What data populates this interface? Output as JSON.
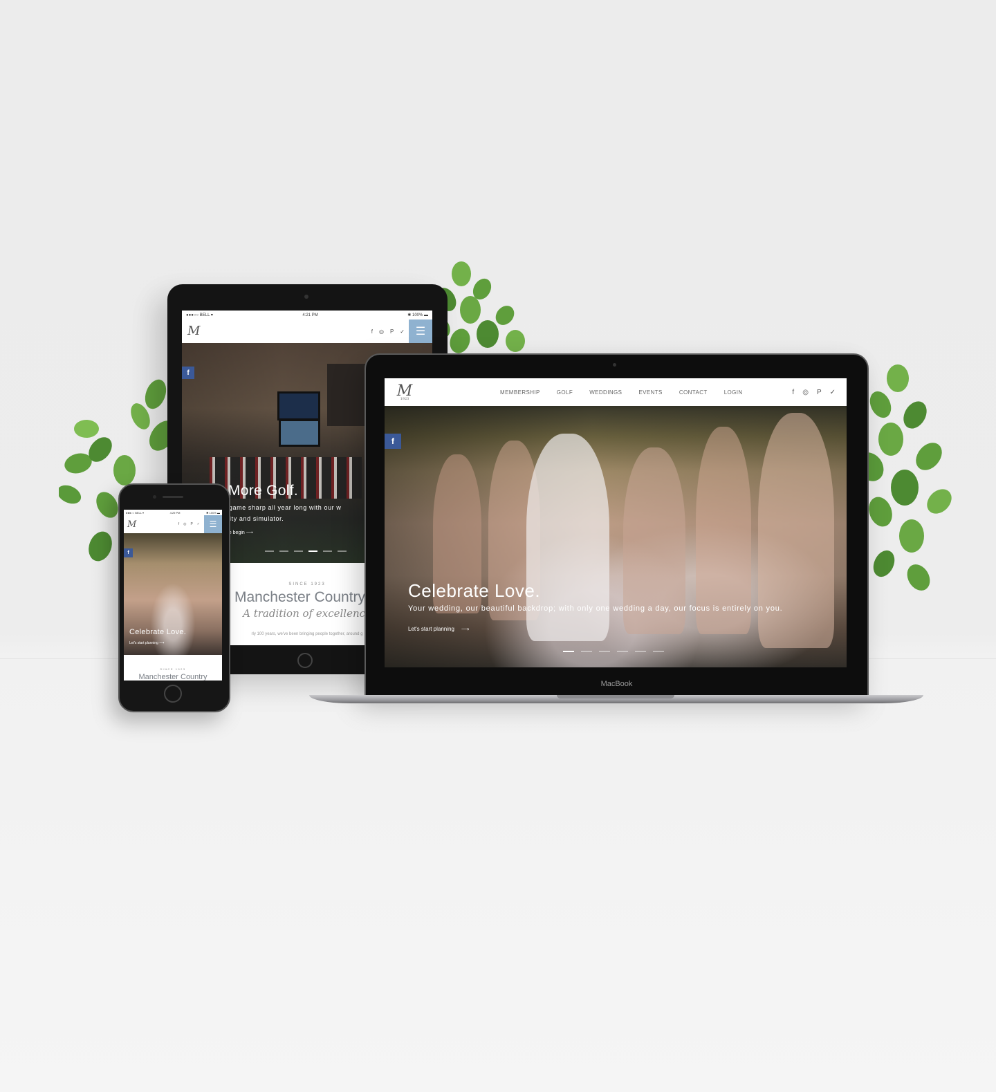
{
  "tablet": {
    "status": {
      "carrier": "●●●○○ BELL ▾",
      "time": "4:21 PM",
      "battery": "✱ 100% ▬"
    },
    "logo": "M",
    "social": [
      "f",
      "◎",
      "P",
      "✓"
    ],
    "menu_icon": "☰",
    "fb": "f",
    "hero_title": "y More Golf.",
    "hero_sub_line1": "our game sharp all year long with our w",
    "hero_sub_line2": "facility and simulator.",
    "cta": "me begin  ⟶",
    "since": "SINCE 1923",
    "club": "Manchester Country C",
    "tradition": "A tradition of excellence",
    "body": "rly 100 years, we've been bringing people together, around g"
  },
  "laptop": {
    "logo_mark": "M",
    "logo_year": "1923",
    "menu": [
      "MEMBERSHIP",
      "GOLF",
      "WEDDINGS",
      "EVENTS",
      "CONTACT",
      "LOGIN"
    ],
    "social": [
      "f",
      "◎",
      "P",
      "✓"
    ],
    "fb": "f",
    "hero_title": "Celebrate Love.",
    "hero_sub": "Your wedding, our beautiful backdrop; with only one wedding a day, our focus is entirely on you.",
    "cta": "Let's start planning",
    "cta_arrow": "⟶",
    "brand": "MacBook"
  },
  "phone": {
    "status": {
      "carrier": "●●●○○ BELL ▾",
      "time": "4:29 PM",
      "battery": "✱ 100% ▬"
    },
    "logo": "M",
    "social": [
      "f",
      "◎",
      "P",
      "✓"
    ],
    "menu_icon": "☰",
    "fb": "f",
    "hero_title": "Celebrate Love.",
    "cta": "Let's start planning  ⟶",
    "since": "SINCE 1923",
    "club": "Manchester Country"
  },
  "colors": {
    "facebook": "#3b5998",
    "menu_accent": "#8fb2d0",
    "nav_text": "#666666"
  }
}
